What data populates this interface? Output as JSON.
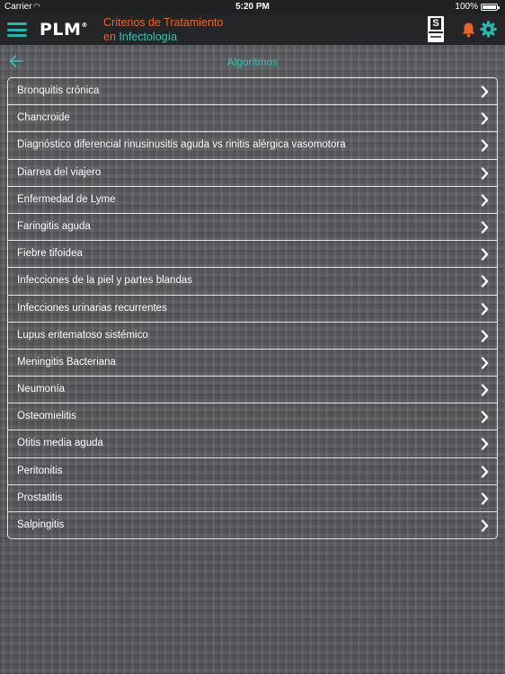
{
  "status_bar": {
    "carrier": "Carrier",
    "time": "5:20 PM",
    "battery": "100%"
  },
  "header": {
    "logo": "PLM",
    "logo_mark": "®",
    "title_line1": "Criterios de Tratamiento",
    "title_line2_prefix": "en ",
    "title_line2_accent": "Infectología",
    "icons": [
      "menu-icon",
      "seal-icon",
      "bell-icon",
      "gear-icon"
    ],
    "colors": {
      "accent": "#3cc2b8",
      "orange": "#e8662a",
      "bar": "#232527"
    }
  },
  "subnav": {
    "title": "Algoritmos",
    "back_icon": "back-arrow-icon"
  },
  "list": {
    "items": [
      "Bronquitis crónica",
      "Chancroide",
      "Diagnóstico diferencial rinusinusitis aguda vs rinitis alérgica vasomotora",
      "Diarrea del viajero",
      "Enfermedad de Lyme",
      "Faringitis aguda",
      "Fiebre tifoidea",
      "Infecciones de la piel y partes blandas",
      "Infecciones urinarias recurrentes",
      "Lupus eritematoso sistémico",
      "Meningitis Bacteriana",
      "Neumonía",
      "Osteomielitis",
      "Otitis media aguda",
      "Peritonitis",
      "Prostatitis",
      "Salpingitis"
    ]
  }
}
